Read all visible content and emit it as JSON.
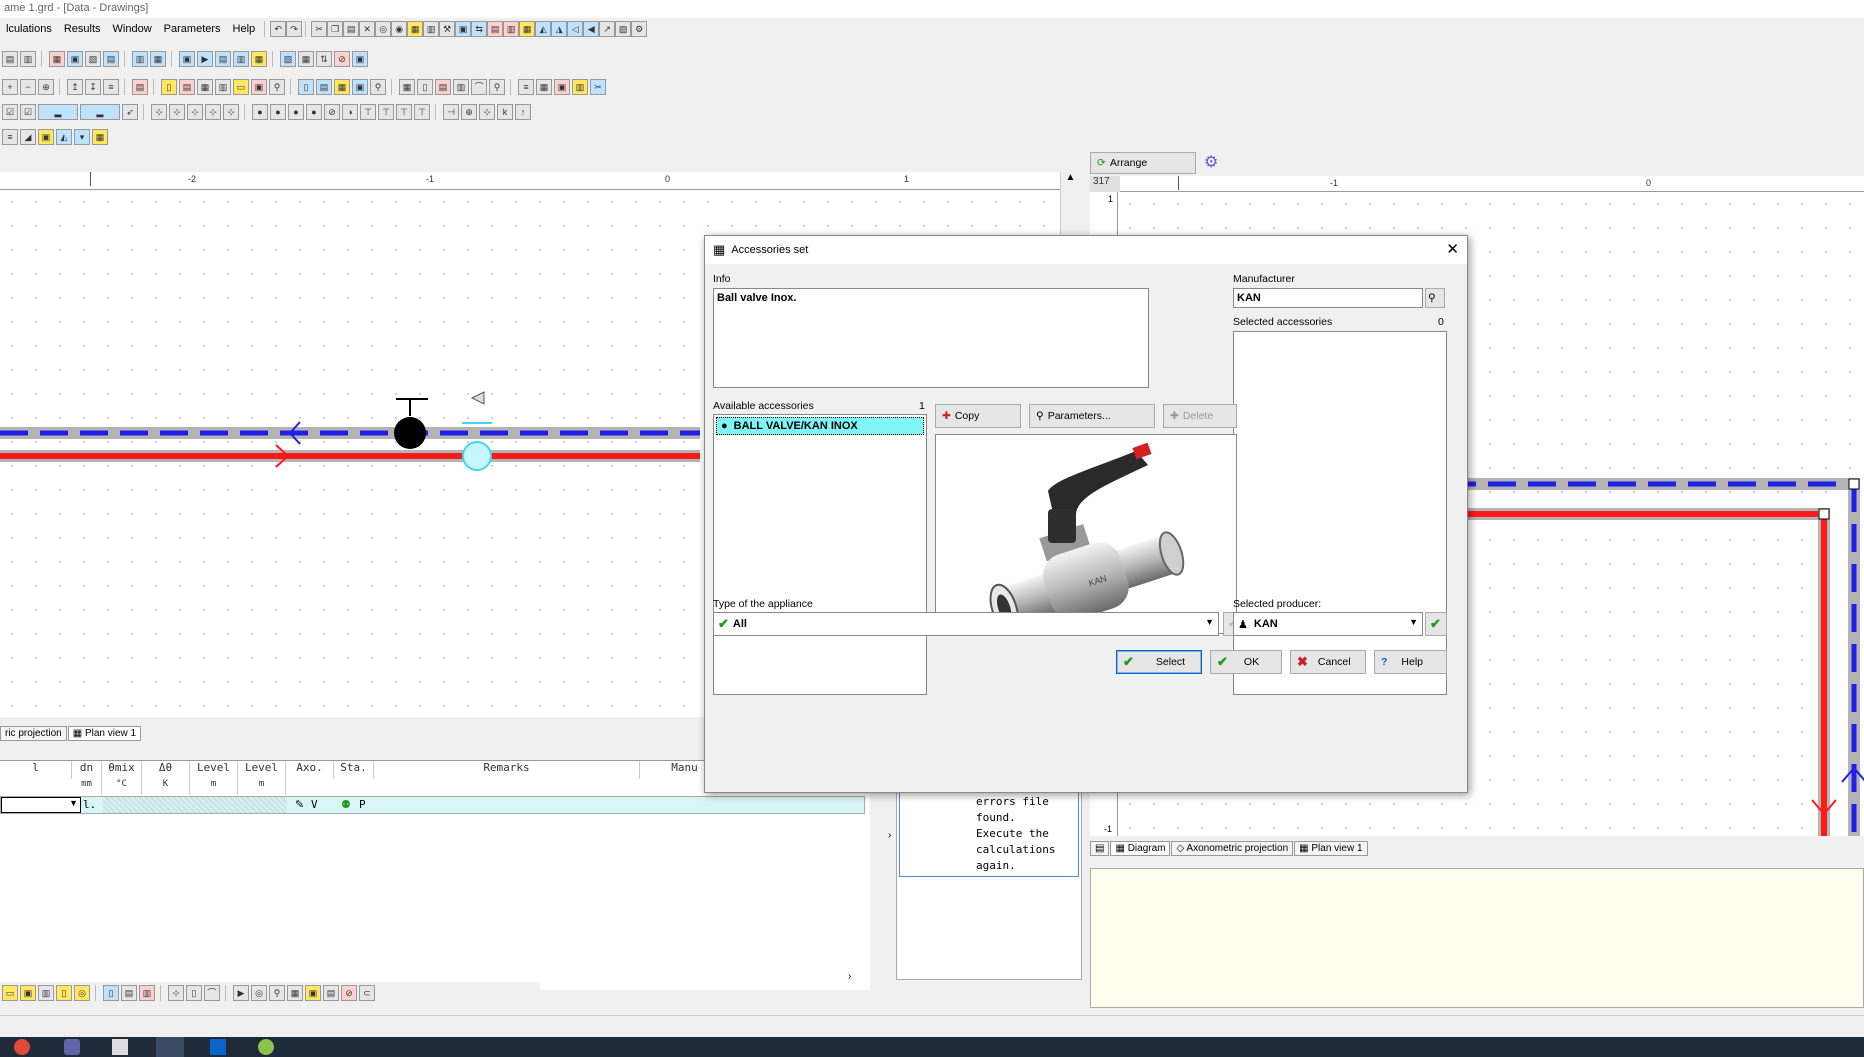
{
  "window": {
    "title": "ame 1.grd - [Data - Drawings]"
  },
  "menu": [
    "lculations",
    "Results",
    "Window",
    "Parameters",
    "Help"
  ],
  "left_ruler": {
    "labels": [
      "-2",
      "-1",
      "0",
      "1"
    ]
  },
  "right_panel": {
    "arrange_label": "Arrange",
    "ruler_value": "317",
    "ruler_labels": [
      "-1",
      "0"
    ],
    "vruler_labels": [
      "1",
      "-1"
    ],
    "tabs": [
      "Diagram",
      "Axonometric projection",
      "Plan view 1"
    ]
  },
  "left_tabs": [
    "ric projection",
    "Plan view 1"
  ],
  "table": {
    "headers": [
      {
        "top": "l",
        "unit": ""
      },
      {
        "top": "dn",
        "unit": "mm"
      },
      {
        "top": "θmix",
        "unit": "°C"
      },
      {
        "top": "Δθ",
        "unit": "K"
      },
      {
        "top": "Level",
        "unit": "m"
      },
      {
        "top": "Level",
        "unit": "m"
      },
      {
        "top": "Axo.",
        "unit": ""
      },
      {
        "top": "Sta.",
        "unit": ""
      },
      {
        "top": "Remarks",
        "unit": ""
      },
      {
        "top": "Manu",
        "unit": ""
      }
    ],
    "row": {
      "c1": "l.",
      "axo": "V",
      "sta": "P"
    }
  },
  "messages": {
    "text": "1: No file of errors file found. Execute the calculations again.",
    "lines": [
      "errors file",
      "found.",
      "Execute the",
      "calculations",
      "again."
    ]
  },
  "dialog": {
    "title": "Accessories set",
    "info_label": "Info",
    "info_text": "Ball valve Inox.",
    "manufacturer_label": "Manufacturer",
    "manufacturer_value": "KAN",
    "selected_accessories_label": "Selected accessories",
    "selected_accessories_count": "0",
    "available_label": "Available accessories",
    "available_count": "1",
    "available_items": [
      "BALL VALVE/KAN INOX"
    ],
    "copy_label": "Copy",
    "parameters_label": "Parameters...",
    "delete_label": "Delete",
    "type_label": "Type of the appliance",
    "type_value": "All",
    "producer_label": "Selected producer:",
    "producer_value": "KAN",
    "select_label": "Select",
    "ok_label": "OK",
    "cancel_label": "Cancel",
    "help_label": "Help"
  },
  "colors": {
    "supply": "#ff1a1a",
    "return": "#1f1fe6",
    "pipe_casing": "#b4b4b4",
    "selected_item": "#7ff5f5"
  }
}
